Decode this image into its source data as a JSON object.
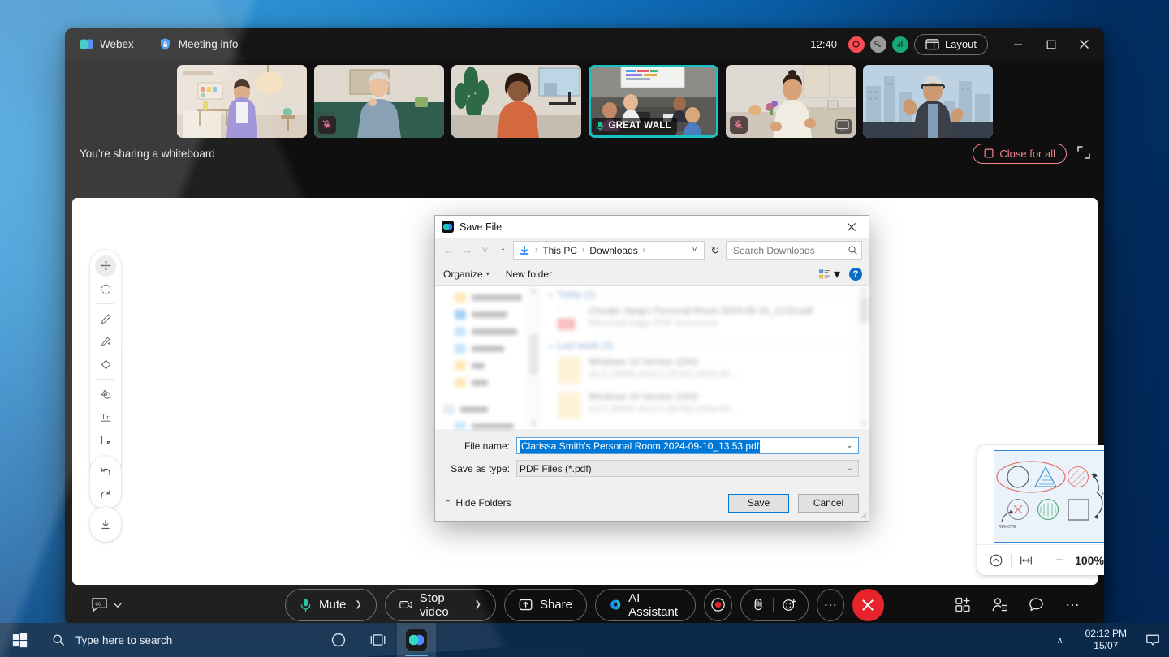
{
  "window": {
    "app_name": "Webex",
    "meeting_info_label": "Meeting info",
    "clock": "12:40",
    "layout_label": "Layout",
    "status_icons": [
      "record-status-icon",
      "key-status-icon",
      "network-status-icon"
    ],
    "controls": {
      "minimize": "–",
      "maximize": "□",
      "close": "✕"
    }
  },
  "video_strip": {
    "participants": [
      {
        "name": "",
        "muted": false,
        "active": false
      },
      {
        "name": "",
        "muted": true,
        "active": false
      },
      {
        "name": "",
        "muted": false,
        "active": false
      },
      {
        "name": "GREAT WALL",
        "muted": true,
        "active": true
      },
      {
        "name": "",
        "muted": true,
        "active": false
      },
      {
        "name": "",
        "muted": false,
        "active": false
      }
    ]
  },
  "share_bar": {
    "status_text": "You’re sharing a whiteboard",
    "close_for_all_label": "Close for all",
    "expand_icon": "expand-icon"
  },
  "whiteboard_tools": {
    "group1": [
      "move-tool",
      "select-tool",
      "pen-tool",
      "highlighter-tool",
      "eraser-tool",
      "shape-tool",
      "text-tool",
      "note-tool",
      "emoji-tool"
    ],
    "group2": [
      "undo-tool",
      "redo-tool"
    ],
    "group3": [
      "download-tool"
    ]
  },
  "minimap": {
    "zoom_level": "100%",
    "collapse_icon": "collapse-icon",
    "fit_icon": "fit-width-icon",
    "zoom_out": "−",
    "zoom_in": "+",
    "annotations": {
      "phase": "PHASE IV",
      "remove": "REMOVE"
    }
  },
  "save_dialog": {
    "title": "Save File",
    "close_label": "✕",
    "nav": {
      "back": "←",
      "forward": "→",
      "recent": "˅",
      "up": "↑",
      "breadcrumb": [
        "This PC",
        "Downloads"
      ],
      "breadcrumb_sep": "›",
      "dropdown": "˅",
      "refresh": "↻"
    },
    "search": {
      "placeholder": "Search Downloads",
      "icon": "search-icon"
    },
    "commands": {
      "organize": "Organize",
      "new_folder": "New folder",
      "view_icon": "view-options-icon",
      "help_icon": "?"
    },
    "tree_items": [
      {
        "label": "Attachments",
        "color": "yellow"
      },
      {
        "label": "Desktop",
        "color": "blue"
      },
      {
        "label": "Documents",
        "color": "lblue"
      },
      {
        "label": "Pictures",
        "color": "lblue"
      },
      {
        "label": "text",
        "color": "yellow"
      },
      {
        "label": "文件",
        "color": "yellow"
      },
      {
        "label": "This PC",
        "color": "gray"
      },
      {
        "label": "3D Objects",
        "color": "lblue"
      },
      {
        "label": "Desktop",
        "color": "blue"
      }
    ],
    "file_groups": [
      {
        "header": "Today (1)",
        "files": [
          {
            "name": "Chunjie Jiang's Personal Room 2024-05-16_13.53.pdf",
            "type": "Microsoft Edge PDF Document",
            "icon": "pdf"
          }
        ]
      },
      {
        "header": "Last week (3)",
        "files": [
          {
            "name": "Windows 10 Version 22H2",
            "type": "10.0.19045.44.6.0.29743-2024-05...",
            "icon": "folder"
          },
          {
            "name": "Windows 10 Version 22H2",
            "type": "10.0.19045.44.6.0.29743-2024-05...",
            "icon": "folder"
          }
        ]
      }
    ],
    "fields": {
      "filename_label": "File name:",
      "filename_value": "Clarissa Smith's Personal Room 2024-09-10_13.53.pdf",
      "filetype_label": "Save as type:",
      "filetype_value": "PDF Files (*.pdf)"
    },
    "footer": {
      "hide_folders": "Hide Folders",
      "save": "Save",
      "cancel": "Cancel"
    }
  },
  "control_bar": {
    "cc_icon": "closed-captions-icon",
    "mute_label": "Mute",
    "stop_video_label": "Stop video",
    "share_label": "Share",
    "ai_assistant_label": "AI Assistant",
    "record_icon": "record-icon",
    "reactions_hand_icon": "raise-hand-icon",
    "reactions_emoji_icon": "emoji-reaction-icon",
    "more_icon": "…",
    "end_call_icon": "✕",
    "right_icons": [
      "apps-icon",
      "participants-icon",
      "chat-icon",
      "more-options-icon"
    ]
  },
  "taskbar": {
    "start_icon": "windows-start-icon",
    "search_placeholder": "Type here to search",
    "cortana_icon": "cortana-icon",
    "taskview_icon": "task-view-icon",
    "webex_icon": "webex-taskbar-icon",
    "tray_chevron": "∧",
    "clock_time": "02:12 PM",
    "clock_date": "15/07",
    "notification_icon": "notifications-icon"
  }
}
